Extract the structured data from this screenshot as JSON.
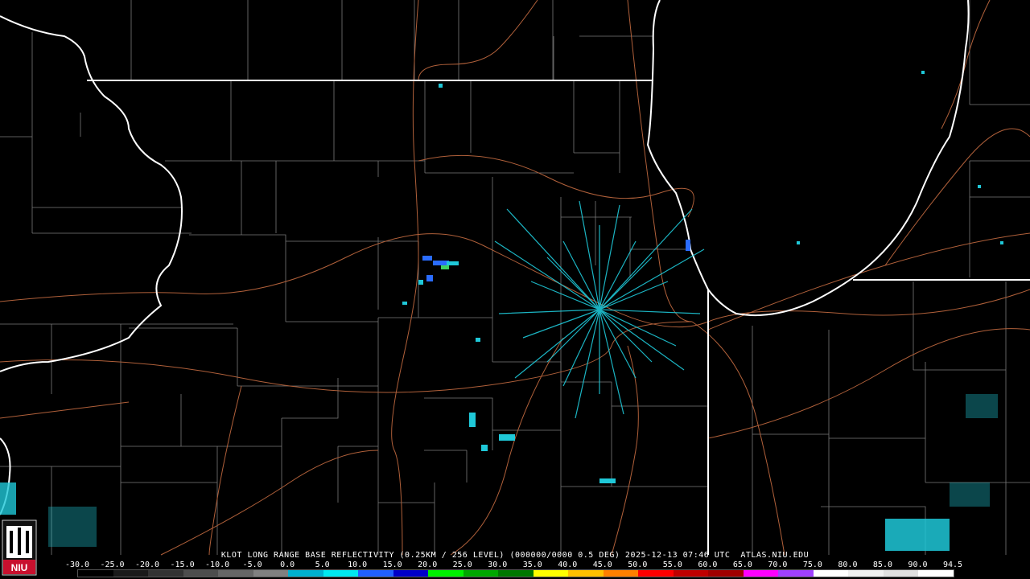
{
  "caption": "KLOT LONG RANGE BASE REFLECTIVITY (0.25KM / 256 LEVEL) (000000/0000 0.5 DEG) 2025-12-13 07:46 UTC  ATLAS.NIU.EDU",
  "logo_text": "NIU",
  "scale": {
    "ticks": [
      "-30.0",
      "-25.0",
      "-20.0",
      "-15.0",
      "-10.0",
      "-5.0",
      "0.0",
      "5.0",
      "10.0",
      "15.0",
      "20.0",
      "25.0",
      "30.0",
      "35.0",
      "40.0",
      "45.0",
      "50.0",
      "55.0",
      "60.0",
      "65.0",
      "70.0",
      "75.0",
      "80.0",
      "85.0",
      "90.0",
      "94.5"
    ],
    "colors": [
      "#000000",
      "#1a1a1a",
      "#333333",
      "#4d4d4d",
      "#666666",
      "#808080",
      "#00b0d0",
      "#00e8f0",
      "#2060ff",
      "#0000c8",
      "#00f000",
      "#00a800",
      "#007800",
      "#ffff00",
      "#ffc000",
      "#ff8000",
      "#ff0000",
      "#c00000",
      "#a00000",
      "#ff00ff",
      "#a040ff",
      "#ffffff",
      "#f0f0f0",
      "#e0e0e0",
      "#ffffff"
    ]
  },
  "colors": {
    "state_border": "#ffffff",
    "county_border": "#808080",
    "highway": "#b0603a",
    "echo_light": "#1fc8d8",
    "echo_blue": "#2a6cff",
    "echo_green": "#40d060"
  }
}
